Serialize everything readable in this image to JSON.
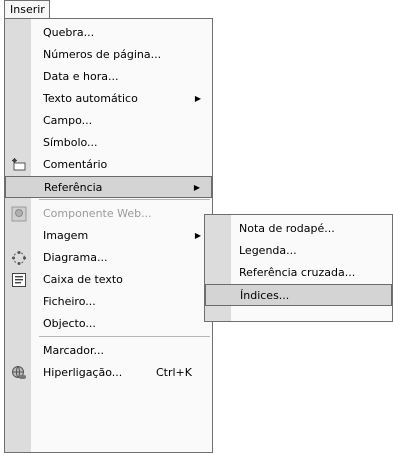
{
  "menubar": {
    "active_menu_label": "Inserir"
  },
  "main_menu": {
    "items": [
      {
        "label": "Quebra...",
        "icon": "",
        "has_submenu": false,
        "shortcut": ""
      },
      {
        "label": "Números de página...",
        "icon": "",
        "has_submenu": false,
        "shortcut": ""
      },
      {
        "label": "Data e hora...",
        "icon": "",
        "has_submenu": false,
        "shortcut": ""
      },
      {
        "label": "Texto automático",
        "icon": "",
        "has_submenu": true,
        "shortcut": ""
      },
      {
        "label": "Campo...",
        "icon": "",
        "has_submenu": false,
        "shortcut": ""
      },
      {
        "label": "Símbolo...",
        "icon": "",
        "has_submenu": false,
        "shortcut": ""
      },
      {
        "label": "Comentário",
        "icon": "comment-icon",
        "has_submenu": false,
        "shortcut": ""
      },
      {
        "label": "Referência",
        "icon": "",
        "has_submenu": true,
        "shortcut": "",
        "state": "highlighted"
      },
      {
        "label": "Componente Web...",
        "icon": "web-component-icon",
        "has_submenu": false,
        "shortcut": "",
        "state": "disabled"
      },
      {
        "label": "Imagem",
        "icon": "",
        "has_submenu": true,
        "shortcut": ""
      },
      {
        "label": "Diagrama...",
        "icon": "diagram-icon",
        "has_submenu": false,
        "shortcut": ""
      },
      {
        "label": "Caixa de texto",
        "icon": "textbox-icon",
        "has_submenu": false,
        "shortcut": ""
      },
      {
        "label": "Ficheiro...",
        "icon": "",
        "has_submenu": false,
        "shortcut": ""
      },
      {
        "label": "Objecto...",
        "icon": "",
        "has_submenu": false,
        "shortcut": ""
      },
      {
        "label": "Marcador...",
        "icon": "",
        "has_submenu": false,
        "shortcut": ""
      },
      {
        "label": "Hiperligação...",
        "icon": "hyperlink-icon",
        "has_submenu": false,
        "shortcut": "Ctrl+K"
      }
    ]
  },
  "submenu": {
    "parent": "Referência",
    "items": [
      {
        "label": "Nota de rodapé...",
        "state": ""
      },
      {
        "label": "Legenda...",
        "state": ""
      },
      {
        "label": "Referência cruzada...",
        "state": ""
      },
      {
        "label": "Índices...",
        "state": "highlighted"
      }
    ]
  },
  "colors": {
    "gutter": "#dcdcdc",
    "menu_background": "#fafafa",
    "highlight": "#d4d4d4",
    "disabled_text": "#9a9a9a"
  }
}
